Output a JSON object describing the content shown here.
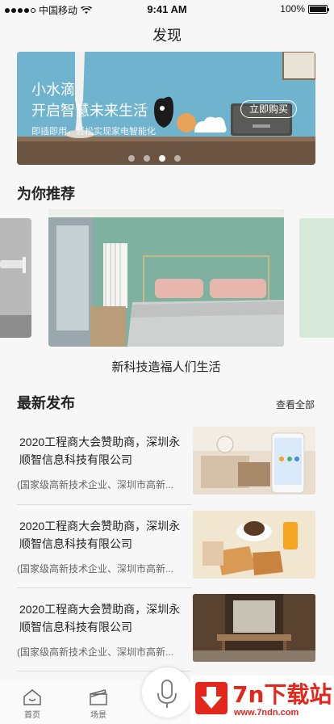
{
  "status_bar": {
    "carrier": "中国移动",
    "time": "9:41 AM",
    "battery": "100%"
  },
  "page": {
    "title": "发现"
  },
  "banner": {
    "title_line1": "小水滴",
    "title_line2": "开启智慧未来生活",
    "subtitle": "即插即用，轻松实现家电智能化",
    "button_label": "立即购买",
    "active_dot": 3,
    "dot_count": 4
  },
  "recommend": {
    "section_title": "为你推荐",
    "caption": "新科技造福人们生活"
  },
  "latest": {
    "section_title": "最新发布",
    "see_all": "查看全部",
    "items": [
      {
        "title": "2020工程商大会赞助商，深圳永顺智信息科技有限公司",
        "desc": "(国家级高新技术企业、深圳市高新..."
      },
      {
        "title": "2020工程商大会赞助商，深圳永顺智信息科技有限公司",
        "desc": "(国家级高新技术企业、深圳市高新..."
      },
      {
        "title": "2020工程商大会赞助商，深圳永顺智信息科技有限公司",
        "desc": "(国家级高新技术企业、深圳市高新..."
      }
    ]
  },
  "tabs": [
    {
      "label": "首页",
      "icon": "home-icon"
    },
    {
      "label": "场景",
      "icon": "scene-icon"
    }
  ],
  "watermark": {
    "brand": "7n下载站",
    "url": "www.7ndn.com"
  }
}
